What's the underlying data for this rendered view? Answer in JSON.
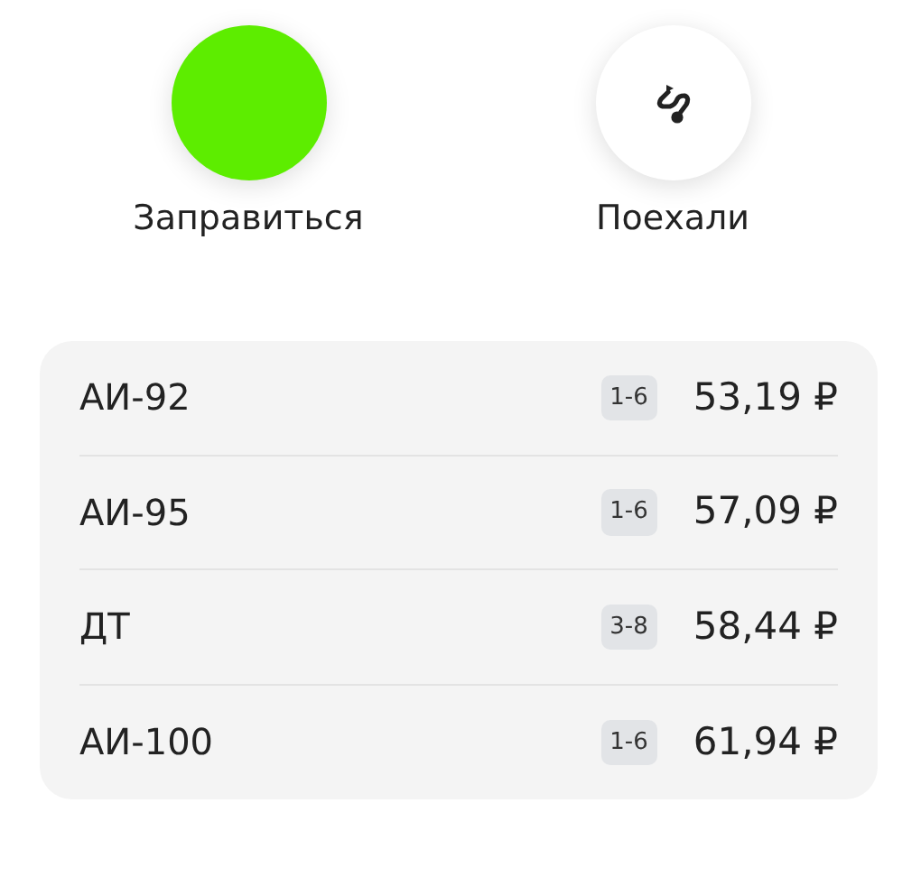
{
  "actions": [
    {
      "label": "Заправиться",
      "kind": "plain",
      "color": "#5ded00"
    },
    {
      "label": "Поехали",
      "kind": "route",
      "color": "#ffffff"
    }
  ],
  "prices": [
    {
      "fuel": "АИ-92",
      "columns": "1-6",
      "price": "53,19 ₽"
    },
    {
      "fuel": "АИ-95",
      "columns": "1-6",
      "price": "57,09 ₽"
    },
    {
      "fuel": "ДТ",
      "columns": "3-8",
      "price": "58,44 ₽"
    },
    {
      "fuel": "АИ-100",
      "columns": "1-6",
      "price": "61,94 ₽"
    }
  ]
}
